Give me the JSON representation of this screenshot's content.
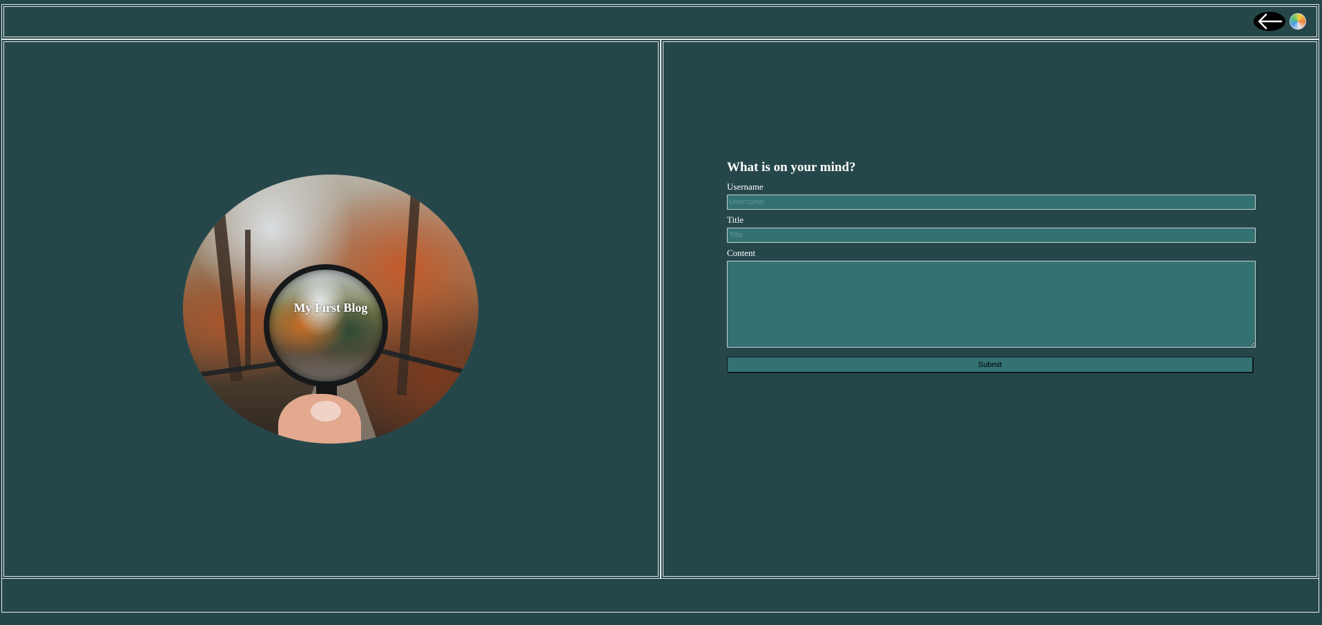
{
  "header": {
    "back_icon": "arrow-left-icon",
    "theme_icon": "color-wheel-icon"
  },
  "hero": {
    "title": "My First Blog",
    "image_subject": "hand-holding-magnifying-glass-autumn-forest"
  },
  "form": {
    "heading": "What is on your mind?",
    "username_label": "Username",
    "username_placeholder": "Username",
    "username_value": "",
    "title_label": "Title",
    "title_placeholder": "Title",
    "title_value": "",
    "content_label": "Content",
    "content_value": "",
    "submit_label": "Submit"
  },
  "colors": {
    "background": "#26474a",
    "input_bg": "#347172",
    "border": "#e6ecec",
    "text": "#ffffff"
  }
}
